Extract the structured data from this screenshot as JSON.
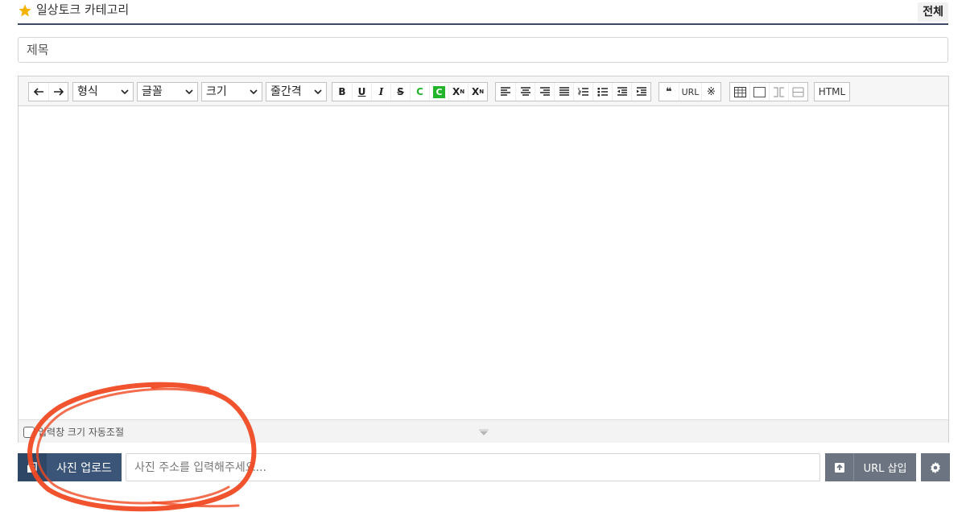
{
  "header": {
    "category_label": "일상토크 카테고리",
    "all_button": "전체"
  },
  "title_field": {
    "placeholder": "제목",
    "value": ""
  },
  "toolbar": {
    "format_select": "형식",
    "font_select": "글꼴",
    "size_select": "크기",
    "line_height_select": "줄간격",
    "bold": "B",
    "underline": "U",
    "italic": "I",
    "strike": "S",
    "font_color": "C",
    "bg_color": "C",
    "superscript": "X",
    "subscript": "X",
    "quote": "❝",
    "url": "URL",
    "special_char": "※",
    "html": "HTML"
  },
  "resize": {
    "auto_resize_label": "입력창 크기 자동조절",
    "checked": false
  },
  "upload": {
    "upload_button": "사진 업로드",
    "url_placeholder": "사진 주소를 입력해주세요...",
    "url_insert_button": "URL 삽입"
  },
  "colors": {
    "primary_dark": "#2f4767",
    "primary": "#3b5578",
    "gray_button": "#6b7480",
    "green": "#22b52b",
    "annotation": "#f04a23",
    "star": "#f5b301"
  }
}
